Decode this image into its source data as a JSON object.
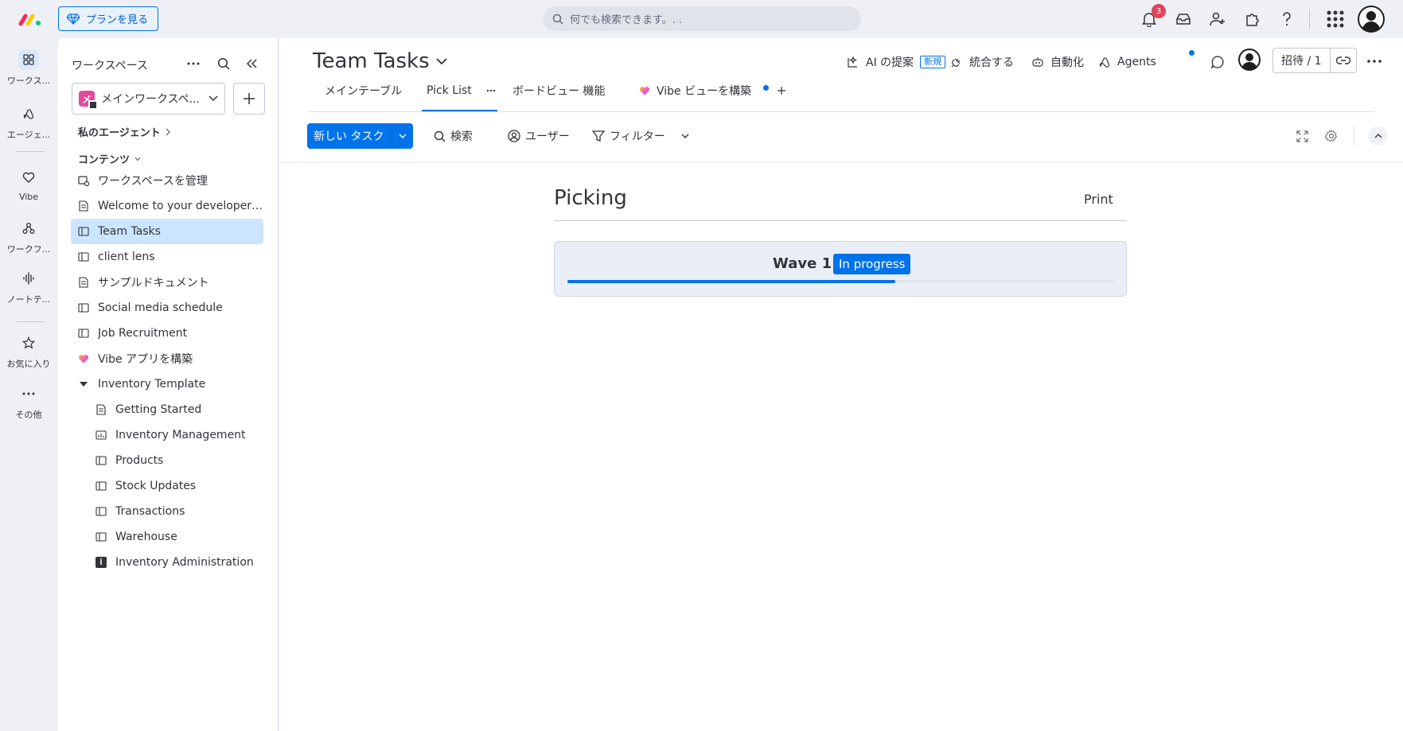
{
  "topbar": {
    "plan_button": "プランを見る",
    "search_placeholder": "何でも検索できます。. .",
    "notification_count": "3"
  },
  "rail": {
    "items": [
      {
        "label": "ワークス..."
      },
      {
        "label": "エージェ..."
      },
      {
        "label": "Vibe"
      },
      {
        "label": "ワークフ..."
      },
      {
        "label": "ノートテ..."
      },
      {
        "label": "お気に入り"
      },
      {
        "label": "その他"
      }
    ]
  },
  "sidebar": {
    "title": "ワークスペース",
    "workspace_name": "メインワークスペ...",
    "workspace_initial": "メ",
    "my_agents": "私のエージェント",
    "contents": "コンテンツ",
    "items": [
      {
        "label": "ワークスペースを管理",
        "icon": "manage-workspace-icon"
      },
      {
        "label": "Welcome to your developer acc...",
        "icon": "doc-icon"
      },
      {
        "label": "Team Tasks",
        "icon": "board-icon"
      },
      {
        "label": "client lens",
        "icon": "board-icon"
      },
      {
        "label": "サンプルドキュメント",
        "icon": "doc-icon"
      },
      {
        "label": "Social media schedule",
        "icon": "board-icon"
      },
      {
        "label": "Job Recruitment",
        "icon": "board-icon"
      },
      {
        "label": "Vibe アプリを構築",
        "icon": "vibe-heart-icon"
      },
      {
        "label": "Inventory Template",
        "icon": "folder-caret-icon"
      }
    ],
    "children": [
      {
        "label": "Getting Started",
        "icon": "doc-icon"
      },
      {
        "label": "Inventory Management",
        "icon": "dashboard-icon"
      },
      {
        "label": "Products",
        "icon": "board-icon"
      },
      {
        "label": "Stock Updates",
        "icon": "board-icon"
      },
      {
        "label": "Transactions",
        "icon": "board-icon"
      },
      {
        "label": "Warehouse",
        "icon": "board-icon"
      },
      {
        "label": "Inventory Administration",
        "icon": "app-icon"
      }
    ]
  },
  "main": {
    "board_title": "Team Tasks",
    "actions": {
      "ai": "AI の提案",
      "ai_tag": "新規",
      "integrate": "統合する",
      "automate": "自動化",
      "agents": "Agents",
      "invite": "招待 / 1"
    },
    "tabs": [
      {
        "label": "メインテーブル"
      },
      {
        "label": "Pick List"
      },
      {
        "label": "ボードビュー 機能"
      },
      {
        "label": "Vibe ビューを構築"
      }
    ],
    "toolbar": {
      "new_task": "新しい タスク",
      "search": "検索",
      "user": "ユーザー",
      "filter": "フィルター"
    }
  },
  "picking": {
    "title": "Picking",
    "print": "Print",
    "wave": {
      "name": "Wave 1",
      "status": "In progress",
      "progress": 0.6
    }
  },
  "colors": {
    "accent": "#0073ea",
    "active_item": "#cce5ff",
    "badge": "#e2445c"
  }
}
